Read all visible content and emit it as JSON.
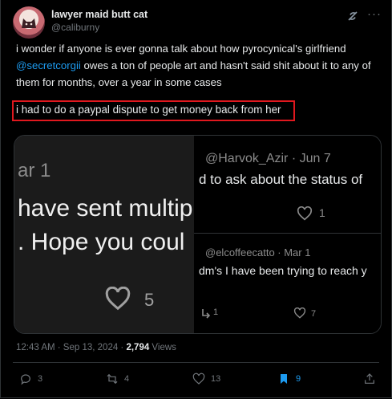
{
  "author": {
    "name": "lawyer maid butt cat",
    "handle": "@caliburny"
  },
  "post": {
    "text_part1": "i wonder if anyone is ever gonna talk about how pyrocynical's girlfriend",
    "mention": "@secretcorgii",
    "text_part2": " owes a ton of people art and hasn't said shit about it to any of them for months, over a year in some cases",
    "highlighted": "i had to do a paypal dispute to get money back from her"
  },
  "media": {
    "left": {
      "date": "ar 1",
      "line1": "have sent multip",
      "line2": ". Hope you coul",
      "likes": "5"
    },
    "right": {
      "reply1_header": "@Harvok_Azir · Jun 7",
      "reply1_text": "d to ask about the status of",
      "reply1_likes": "1",
      "reply2_header": "@elcoffeecatto · Mar 1",
      "reply2_text": "dm's I have been trying to reach y",
      "reply2_replies": "1",
      "reply2_likes": "7"
    }
  },
  "meta": {
    "time": "12:43 AM · Sep 13, 2024 · ",
    "views_count": "2,794",
    "views_label": " Views"
  },
  "actions": {
    "replies": "3",
    "reposts": "4",
    "likes": "13",
    "bookmarks": "9"
  },
  "colors": {
    "accent": "#1d9bf0",
    "highlight_box": "#e0181e"
  }
}
